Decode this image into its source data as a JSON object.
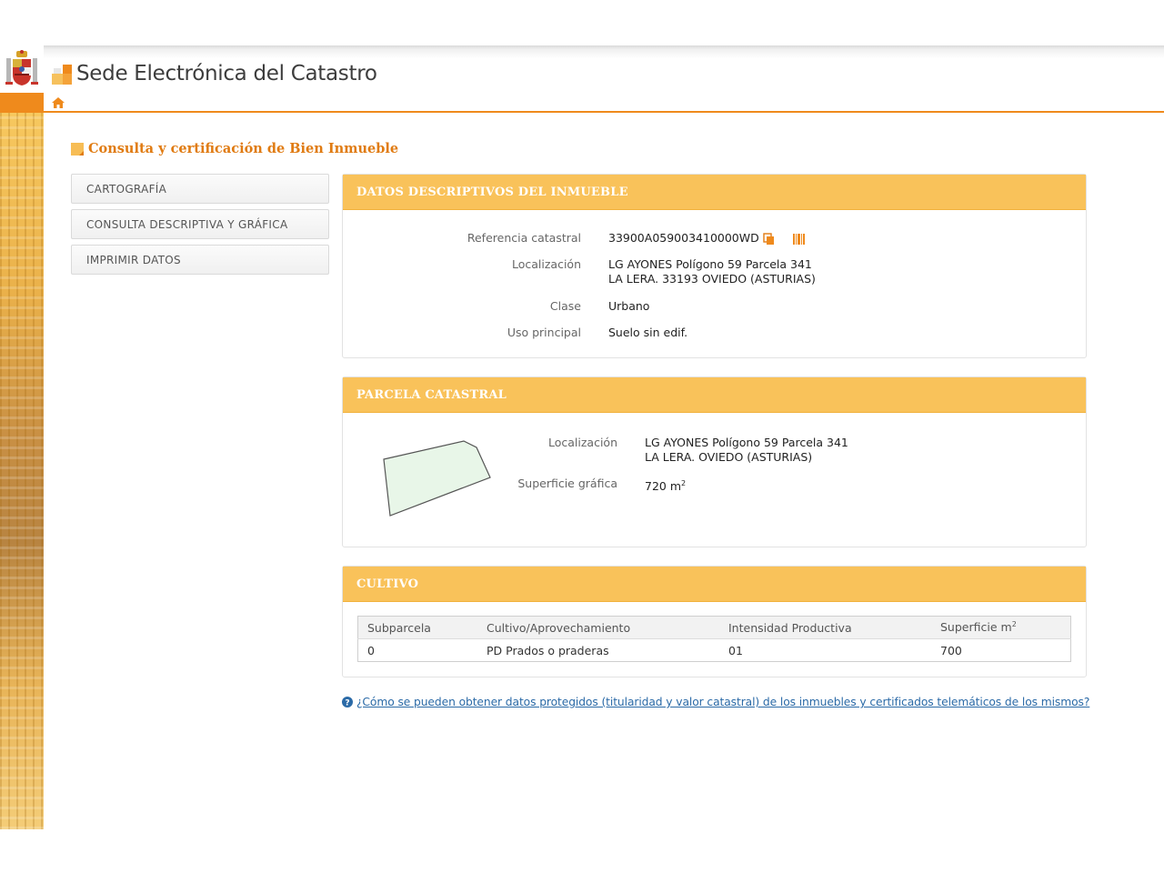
{
  "header": {
    "site_title": "Sede Electrónica del Catastro",
    "crest_icon": "spain-coat-of-arms-icon",
    "logo_icon": "catastro-logo-icon",
    "accent_color": "#ef8a1c"
  },
  "nav": {
    "home_icon": "home-icon"
  },
  "page": {
    "heading": "Consulta y certificación de Bien Inmueble"
  },
  "sidebar": {
    "items": [
      {
        "label": "CARTOGRAFÍA"
      },
      {
        "label": "CONSULTA DESCRIPTIVA Y GRÁFICA"
      },
      {
        "label": "IMPRIMIR DATOS"
      }
    ]
  },
  "datos": {
    "title": "DATOS DESCRIPTIVOS DEL INMUEBLE",
    "fields": {
      "ref_label": "Referencia catastral",
      "ref_value": "33900A059003410000WD",
      "loc_label": "Localización",
      "loc_line1": "LG AYONES Polígono 59 Parcela 341",
      "loc_line2": "LA LERA. 33193 OVIEDO (ASTURIAS)",
      "clase_label": "Clase",
      "clase_value": "Urbano",
      "uso_label": "Uso principal",
      "uso_value": "Suelo sin edif."
    }
  },
  "parcela": {
    "title": "PARCELA CATASTRAL",
    "loc_label": "Localización",
    "loc_line1": "LG AYONES Polígono 59 Parcela 341",
    "loc_line2": "LA LERA. OVIEDO (ASTURIAS)",
    "sup_label": "Superficie gráfica",
    "sup_value": "720 m",
    "sup_unit_exp": "2",
    "parcel_fill": "#e8f6e8"
  },
  "cultivo": {
    "title": "CULTIVO",
    "columns": [
      "Subparcela",
      "Cultivo/Aprovechamiento",
      "Intensidad Productiva",
      "Superficie m"
    ],
    "area_unit_exp": "2",
    "rows": [
      [
        "0",
        "PD Prados o praderas",
        "01",
        "700"
      ]
    ]
  },
  "help": {
    "icon": "question-circle-icon",
    "link_text": "¿Cómo se pueden obtener datos protegidos (titularidad y valor catastral) de los inmuebles y certificados telemáticos de los mismos?"
  }
}
